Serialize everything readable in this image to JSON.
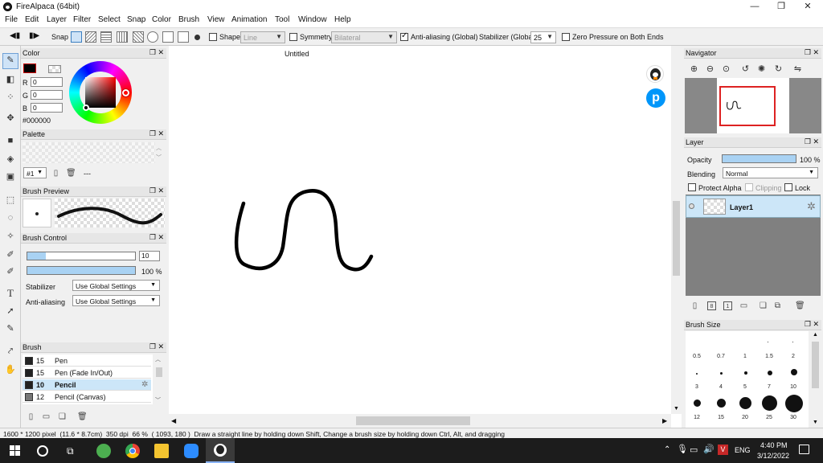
{
  "window": {
    "title": "FireAlpaca (64bit)",
    "minimize": "—",
    "maximize": "❐",
    "close": "✕"
  },
  "menu": [
    "File",
    "Edit",
    "Layer",
    "Filter",
    "Select",
    "Snap",
    "Color",
    "Brush",
    "View",
    "Animation",
    "Tool",
    "Window",
    "Help"
  ],
  "toolbar": {
    "snap": "Snap",
    "shape": "Shape",
    "shape_value": "Line",
    "symmetry": "Symmetry",
    "symmetry_value": "Bilateral",
    "antialiasing": "Anti-aliasing (Global)",
    "stabilizer": "Stabilizer (Global)",
    "stabilizer_value": "25",
    "zero_pressure": "Zero Pressure on Both Ends",
    "antialias_checked": true
  },
  "color_panel": {
    "title": "Color",
    "r_label": "R",
    "g_label": "G",
    "b_label": "B",
    "r": "0",
    "g": "0",
    "b": "0",
    "hex": "#000000"
  },
  "palette_panel": {
    "title": "Palette",
    "selector": "#1",
    "dash": "---"
  },
  "brush_preview": {
    "title": "Brush Preview"
  },
  "brush_control": {
    "title": "Brush Control",
    "size": "10",
    "opacity": "100 %",
    "stabilizer_label": "Stabilizer",
    "stabilizer_value": "Use Global Settings",
    "antialias_label": "Anti-aliasing",
    "antialias_value": "Use Global Settings",
    "size_fraction": 0.17,
    "opacity_fraction": 1.0
  },
  "brush_panel": {
    "title": "Brush",
    "items": [
      {
        "size": "15",
        "name": "Pen"
      },
      {
        "size": "15",
        "name": "Pen (Fade In/Out)"
      },
      {
        "size": "10",
        "name": "Pencil",
        "selected": true
      },
      {
        "size": "12",
        "name": "Pencil (Canvas)"
      }
    ]
  },
  "canvas": {
    "tab": "Untitled"
  },
  "navigator": {
    "title": "Navigator"
  },
  "layer_panel": {
    "title": "Layer",
    "opacity_label": "Opacity",
    "opacity_value": "100 %",
    "opacity_fraction": 1.0,
    "blending_label": "Blending",
    "blending_value": "Normal",
    "protect_alpha": "Protect Alpha",
    "clipping": "Clipping",
    "lock": "Lock",
    "layers": [
      {
        "name": "Layer1"
      }
    ]
  },
  "brush_size_panel": {
    "title": "Brush Size",
    "row1": [
      "0.5",
      "0.7",
      "1",
      "1.5",
      "2"
    ],
    "row2": [
      "3",
      "4",
      "5",
      "7",
      "10"
    ],
    "row3": [
      "12",
      "15",
      "20",
      "25",
      "30"
    ]
  },
  "status": "1600 * 1200 pixel  (11.6 * 8.7cm)  350 dpi  66 %  ( 1093, 180 )  Draw a straight line by holding down Shift, Change a brush size by holding down Ctrl, Alt, and dragging",
  "taskbar": {
    "lang": "ENG",
    "time": "4:40 PM",
    "date": "3/12/2022"
  }
}
